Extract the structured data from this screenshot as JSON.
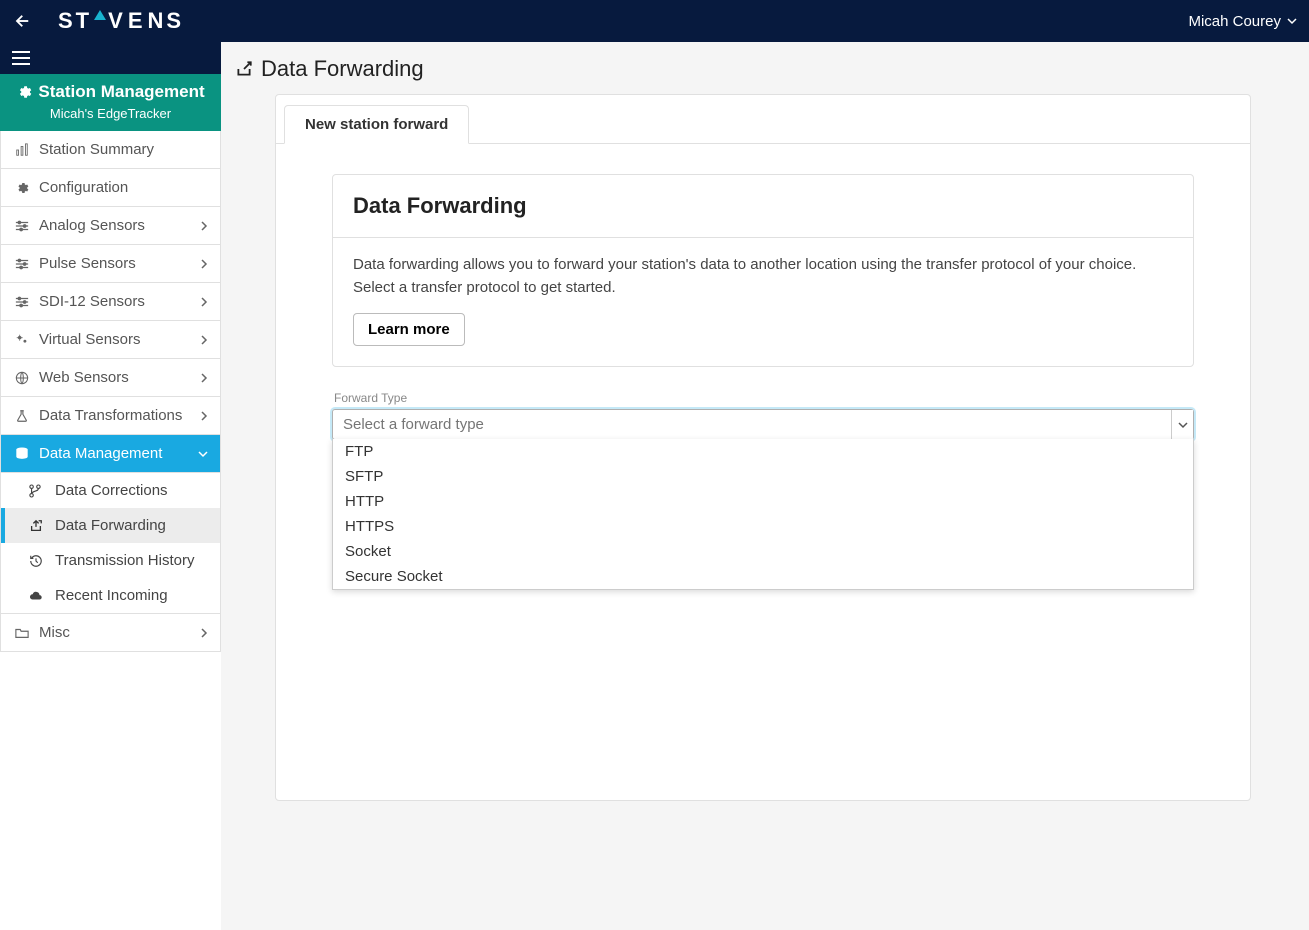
{
  "header": {
    "brand": "STEVENS",
    "user_name": "Micah Courey"
  },
  "sidebar": {
    "station_mgmt_label": "Station Management",
    "station_name": "Micah's EdgeTracker",
    "items": [
      {
        "label": "Station Summary",
        "expandable": false
      },
      {
        "label": "Configuration",
        "expandable": false
      },
      {
        "label": "Analog Sensors",
        "expandable": true
      },
      {
        "label": "Pulse Sensors",
        "expandable": true
      },
      {
        "label": "SDI-12 Sensors",
        "expandable": true
      },
      {
        "label": "Virtual Sensors",
        "expandable": true
      },
      {
        "label": "Web Sensors",
        "expandable": true
      },
      {
        "label": "Data Transformations",
        "expandable": true
      },
      {
        "label": "Data Management",
        "expandable": true,
        "active": true
      },
      {
        "label": "Misc",
        "expandable": true
      }
    ],
    "dm_sub": [
      {
        "label": "Data Corrections"
      },
      {
        "label": "Data Forwarding",
        "selected": true
      },
      {
        "label": "Transmission History"
      },
      {
        "label": "Recent Incoming"
      }
    ]
  },
  "page": {
    "title": "Data Forwarding",
    "tab_label": "New station forward",
    "panel_heading": "Data Forwarding",
    "panel_desc": "Data forwarding allows you to forward your station's data to another location using the transfer protocol of your choice. Select a transfer protocol to get started.",
    "learn_more": "Learn more",
    "forward_type_label": "Forward Type",
    "forward_type_placeholder": "Select a forward type",
    "forward_options": [
      "FTP",
      "SFTP",
      "HTTP",
      "HTTPS",
      "Socket",
      "Secure Socket"
    ]
  }
}
